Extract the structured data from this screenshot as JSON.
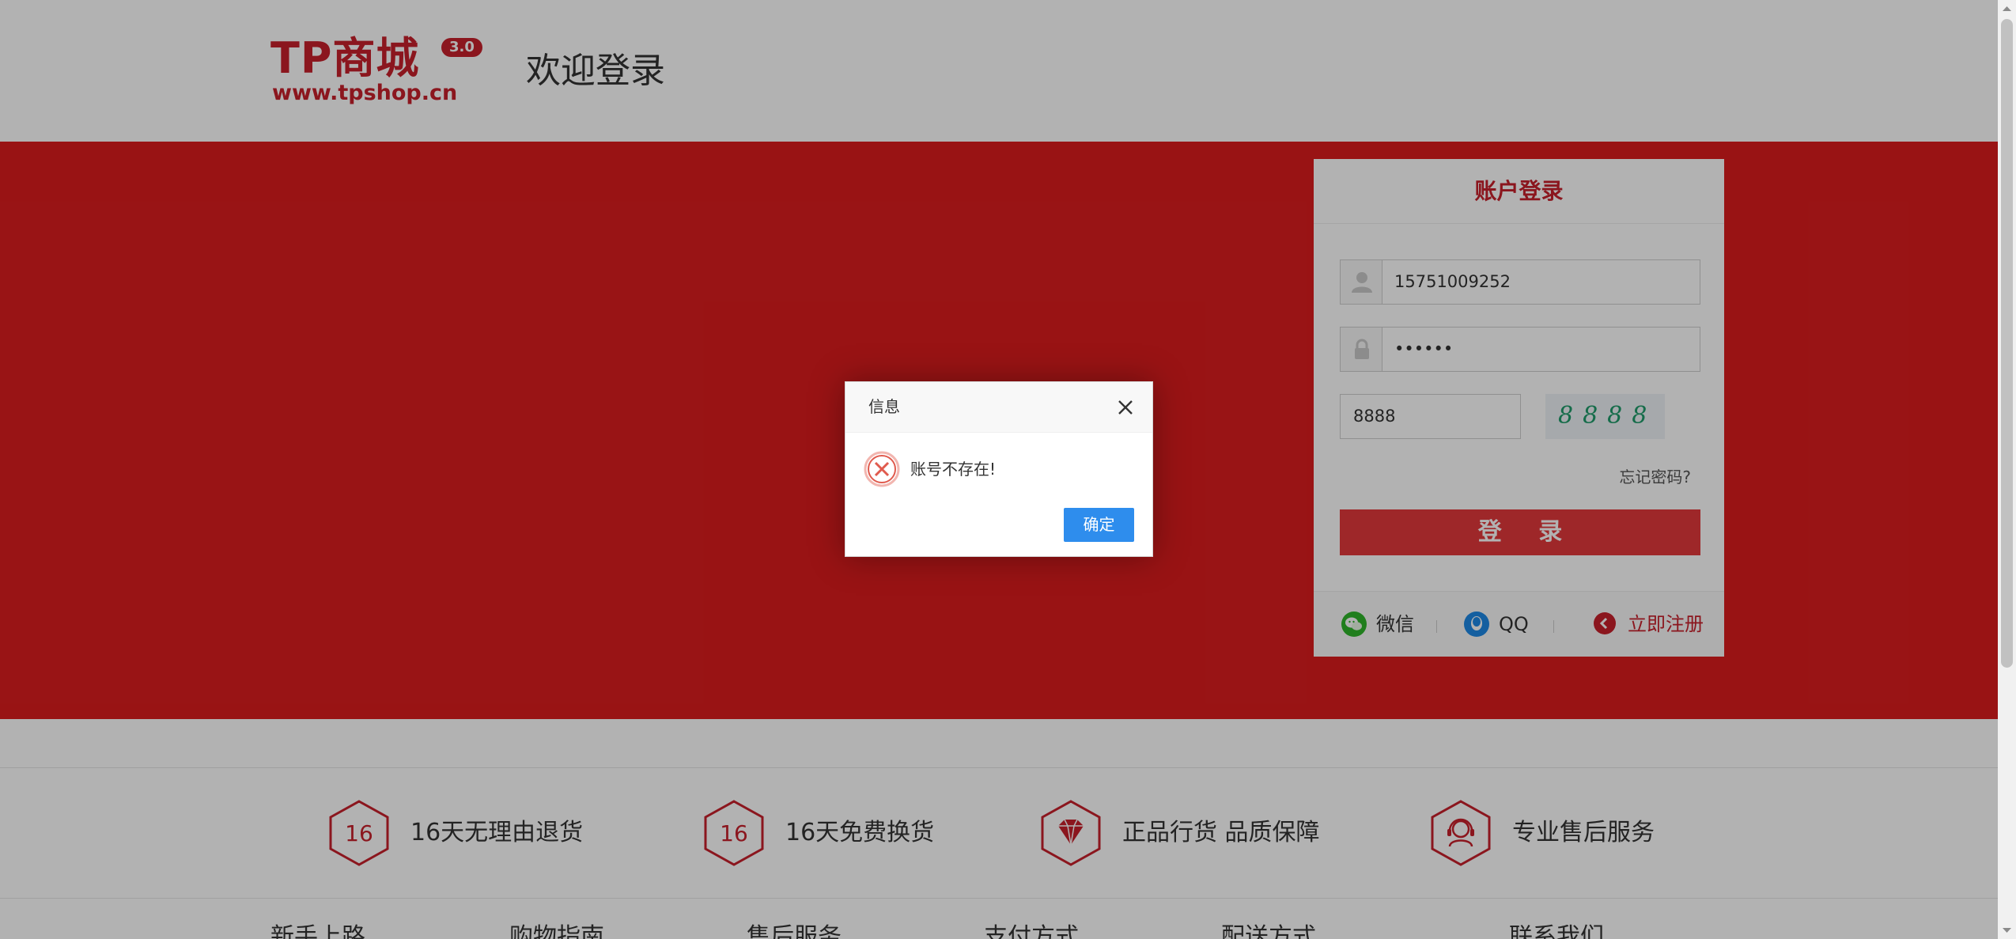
{
  "header": {
    "logo_text": "TP商城",
    "logo_version": "3.0",
    "logo_url": "www.tpshop.cn",
    "welcome": "欢迎登录"
  },
  "login": {
    "title": "账户登录",
    "username_value": "15751009252",
    "password_value": "••••••",
    "captcha_value": "8888",
    "captcha_image_text": "8888",
    "forgot": "忘记密码?",
    "submit": "登 录",
    "wechat": "微信",
    "qq": "QQ",
    "register": "立即注册"
  },
  "features": [
    {
      "badge": "16",
      "text": "16天无理由退货",
      "icon": "hexagon-16-icon"
    },
    {
      "badge": "16",
      "text": "16天免费换货",
      "icon": "hexagon-16-icon"
    },
    {
      "badge": "",
      "text": "正品行货 品质保障",
      "icon": "diamond-icon"
    },
    {
      "badge": "",
      "text": "专业售后服务",
      "icon": "headset-icon"
    }
  ],
  "footer_links": [
    "新手上路",
    "购物指南",
    "售后服务",
    "支付方式",
    "配送方式",
    "联系我们"
  ],
  "dialog": {
    "title": "信息",
    "message": "账号不存在!",
    "ok": "确定"
  },
  "colors": {
    "brand_red": "#c7202b",
    "banner_red": "#db1c1e",
    "dialog_button": "#2e8ded",
    "overlay": "rgba(0,0,0,0.3)"
  }
}
